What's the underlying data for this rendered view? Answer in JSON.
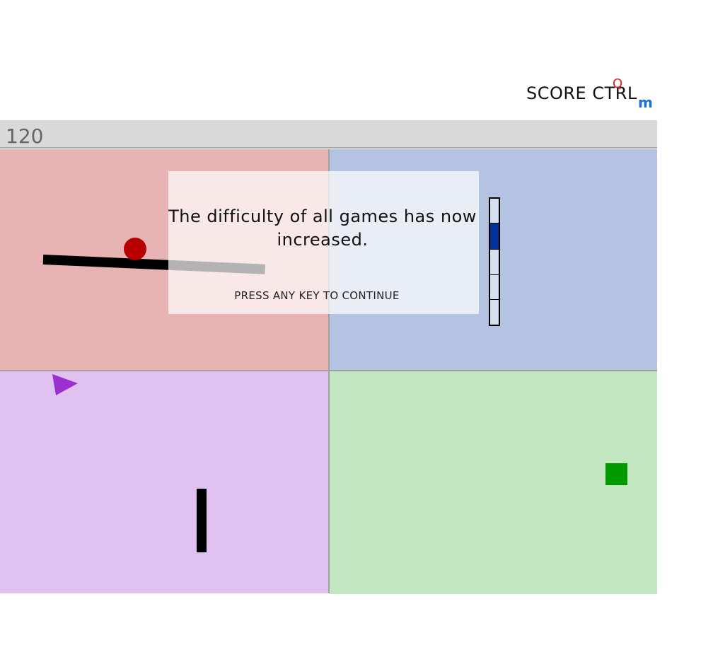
{
  "header": {
    "title": "SCORE CTRL",
    "ctrl_q": "Q",
    "ctrl_m": "m"
  },
  "score": "120",
  "games": {
    "red": {
      "color": "#e8b4b3",
      "ball_color": "#b90000"
    },
    "blue": {
      "color": "#b3c3e1",
      "meter_fill_color": "#003399",
      "meter_level": 1
    },
    "purple": {
      "color": "#e1c1f0",
      "ship_color": "#9b30d0"
    },
    "green": {
      "color": "#c1e6c0",
      "square_color": "#009900"
    }
  },
  "overlay": {
    "message": "The difficulty of all games has now increased.",
    "continue_label": "PRESS ANY KEY TO CONTINUE"
  }
}
